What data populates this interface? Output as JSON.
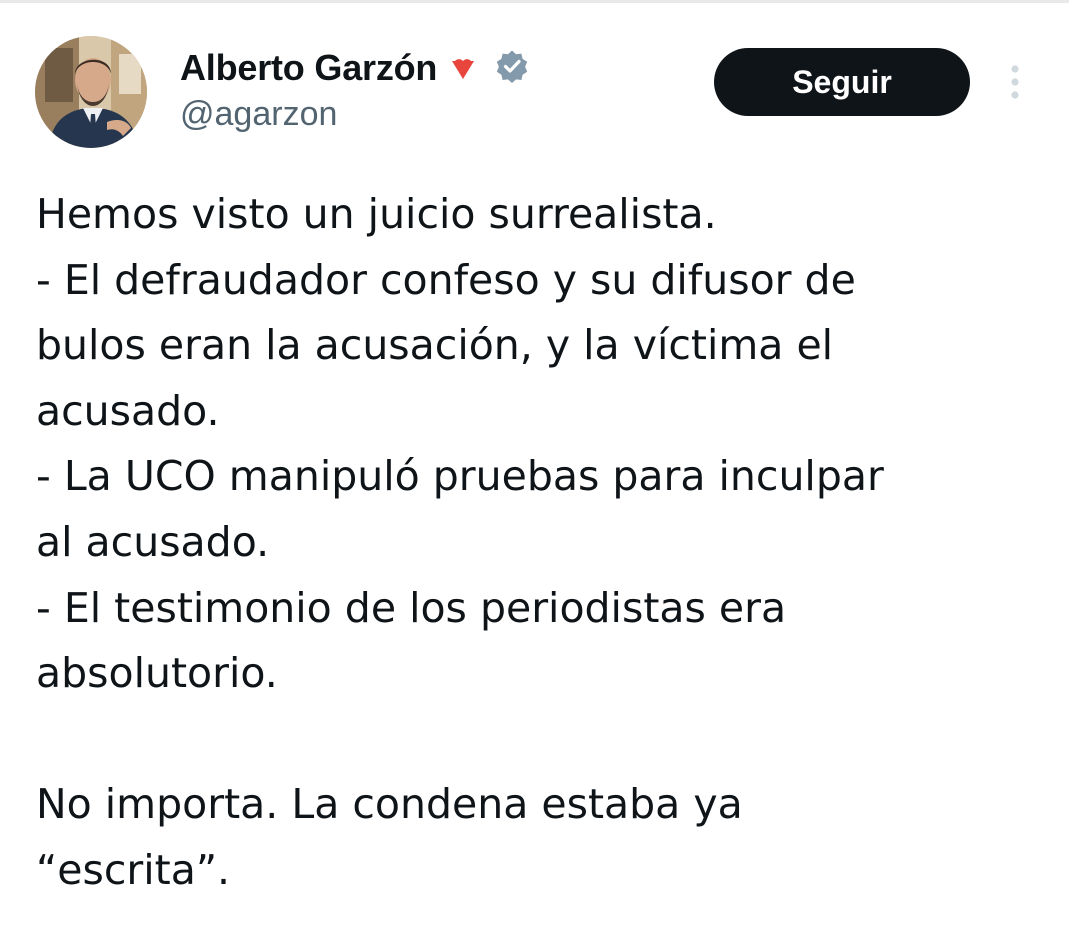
{
  "tweet": {
    "author": {
      "display_name": "Alberto Garzón",
      "handle": "@agarzon",
      "avatar": "profile-photo",
      "badges": [
        "rose-icon",
        "verified-badge-icon"
      ]
    },
    "follow_label": "Seguir",
    "more_icon": "vertical-ellipsis-icon",
    "text_lines": [
      "Hemos visto un juicio surrealista.",
      "- El defraudador confeso y su difusor de",
      "bulos eran la acusación, y la víctima el",
      "acusado.",
      "- La UCO manipuló pruebas para inculpar",
      "al acusado.",
      "- El testimonio de los periodistas era",
      "absolutorio.",
      "",
      "No importa. La condena estaba ya",
      "“escrita”."
    ]
  },
  "colors": {
    "text": "#0f1419",
    "secondary_text": "#536471",
    "button_bg": "#0f1419",
    "button_text": "#ffffff",
    "rose": "#e8453c",
    "verified": "#829aab",
    "border": "#e7e9ea"
  }
}
